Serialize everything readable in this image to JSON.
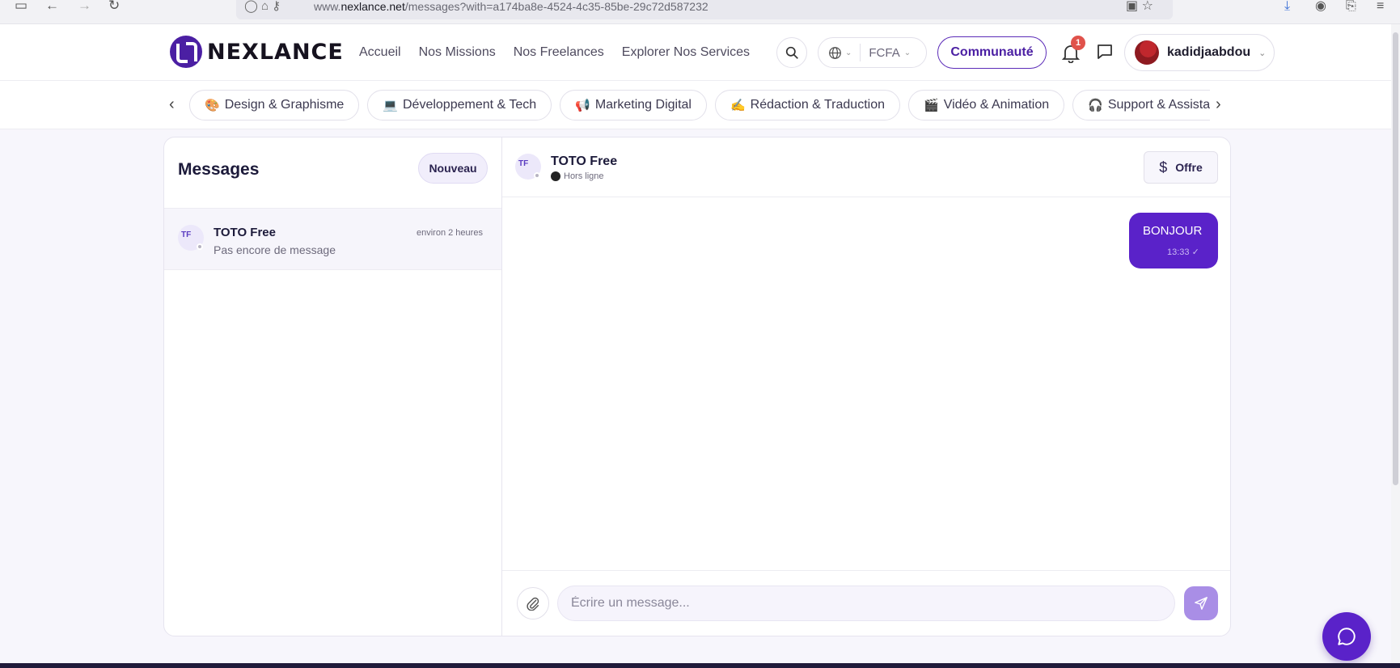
{
  "browser": {
    "url_prefix": "www.",
    "url_domain": "nexlance.net",
    "url_path": "/messages?with=a174ba8e-4524-4c35-85be-29c72d587232"
  },
  "header": {
    "logo_text": "NEXLANCE",
    "nav": [
      "Accueil",
      "Nos Missions",
      "Nos Freelances",
      "Explorer Nos Services"
    ],
    "currency": "FCFA",
    "community_label": "Communauté",
    "notification_count": "1",
    "username": "kadidjaabdou"
  },
  "categories": [
    {
      "icon": "🎨",
      "label": "Design & Graphisme"
    },
    {
      "icon": "💻",
      "label": "Développement & Tech"
    },
    {
      "icon": "📢",
      "label": "Marketing Digital"
    },
    {
      "icon": "✍️",
      "label": "Rédaction & Traduction"
    },
    {
      "icon": "🎬",
      "label": "Vidéo & Animation"
    },
    {
      "icon": "🎧",
      "label": "Support & Assistance"
    }
  ],
  "messages_panel": {
    "title": "Messages",
    "new_button": "Nouveau",
    "conversations": [
      {
        "initials": "TF",
        "name": "TOTO Free",
        "preview": "Pas encore de message",
        "time": "environ 2 heures"
      }
    ]
  },
  "chat": {
    "initials": "TF",
    "name": "TOTO Free",
    "status": "Hors ligne",
    "offer_label": "Offre",
    "messages": [
      {
        "text": "BONJOUR",
        "time": "13:33 ✓"
      }
    ],
    "input_placeholder": "Écrire un message..."
  },
  "colors": {
    "brand": "#5a22c9",
    "background": "#f7f6fc",
    "notification": "#e0524b"
  }
}
